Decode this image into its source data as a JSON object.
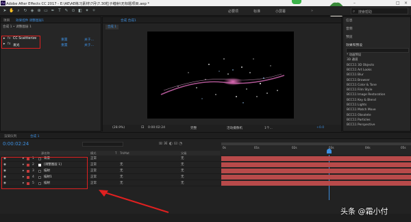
{
  "title": "Adobe After Effects CC 2017 - E:\\AE\\AE练习素材\\7月\\7.30粒子缠射\\无标题项目.aep *",
  "workspace": {
    "tabs": [
      "必要项",
      "标准",
      "小屏幕"
    ],
    "search_placeholder": "搜索帮助"
  },
  "left_panel": {
    "tabs": [
      "项目",
      "效果控件 调整图层1"
    ],
    "breadcrumb": "合成 1 • 调整图层 1",
    "effects": [
      {
        "name": "CC Scattterize",
        "reset": "重置",
        "about": "关于..."
      },
      {
        "name": "发光",
        "reset": "重置",
        "about": "关于..."
      }
    ]
  },
  "viewer": {
    "tab": "合成 合成1",
    "subtab": "合成 1",
    "zoom": "(28.9%)",
    "timecode": "0:00:02:24",
    "quality": "完整",
    "camera": "活动摄像机",
    "views": "1个...",
    "exposure": "+0.0"
  },
  "right_panel": {
    "sections": [
      "信息",
      "音频",
      "预览",
      "效果和预设"
    ],
    "effects_list": [
      "* 动画预设",
      "3D 通道",
      "BCC11 3D Objects",
      "BCC11 Art Looks",
      "BCC11 Blur",
      "BCC11 Browser",
      "BCC11 Color & Tone",
      "BCC11 Film Style",
      "BCC11 Image Restoration",
      "BCC11 Key & Blend",
      "BCC11 Lights",
      "BCC11 Match Move",
      "BCC11 Obsolete",
      "BCC11 Particles",
      "BCC11 Perspective"
    ]
  },
  "timeline": {
    "tabs": [
      "渲染队列",
      "合成 1"
    ],
    "timecode": "0:00:02:24",
    "columns": [
      "源名称",
      "模式",
      "T",
      "TrkMat",
      "父级"
    ],
    "ruler": [
      "0s",
      "01s",
      "02s",
      "03s",
      "04s",
      "05s"
    ],
    "layers": [
      {
        "num": "1",
        "name": "背景",
        "mode": "正常",
        "trkmat": "",
        "parent": "无",
        "swatch": "#c43c3c",
        "thumb": "#111111"
      },
      {
        "num": "2",
        "name": "[调整图层 1]",
        "mode": "正常",
        "trkmat": "无",
        "parent": "无",
        "swatch": "#c43c3c",
        "thumb": "#ffffff"
      },
      {
        "num": "3",
        "name": "描射",
        "mode": "正常",
        "trkmat": "无",
        "parent": "无",
        "swatch": "#c43c3c",
        "thumb": "#111111"
      },
      {
        "num": "4",
        "name": "描射1",
        "mode": "正常",
        "trkmat": "无",
        "parent": "无",
        "swatch": "#c43c3c",
        "thumb": "#111111"
      },
      {
        "num": "5",
        "name": "描射",
        "mode": "正常",
        "trkmat": "无",
        "parent": "无",
        "swatch": "#c43c3c",
        "thumb": "#111111"
      }
    ]
  },
  "watermark": "头条 @霜小付",
  "colors": {
    "accent": "#3d8fe0",
    "annotation_red": "#e02020",
    "track_bar": "#b84a4a"
  }
}
